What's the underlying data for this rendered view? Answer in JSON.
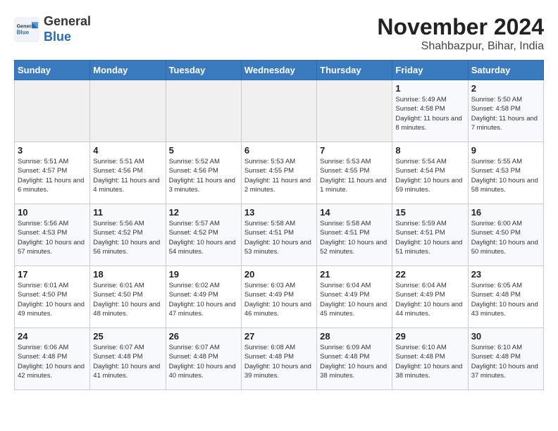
{
  "header": {
    "logo_general": "General",
    "logo_blue": "Blue",
    "month_year": "November 2024",
    "location": "Shahbazpur, Bihar, India"
  },
  "weekdays": [
    "Sunday",
    "Monday",
    "Tuesday",
    "Wednesday",
    "Thursday",
    "Friday",
    "Saturday"
  ],
  "weeks": [
    [
      {
        "day": "",
        "info": ""
      },
      {
        "day": "",
        "info": ""
      },
      {
        "day": "",
        "info": ""
      },
      {
        "day": "",
        "info": ""
      },
      {
        "day": "",
        "info": ""
      },
      {
        "day": "1",
        "info": "Sunrise: 5:49 AM\nSunset: 4:58 PM\nDaylight: 11 hours and 8 minutes."
      },
      {
        "day": "2",
        "info": "Sunrise: 5:50 AM\nSunset: 4:58 PM\nDaylight: 11 hours and 7 minutes."
      }
    ],
    [
      {
        "day": "3",
        "info": "Sunrise: 5:51 AM\nSunset: 4:57 PM\nDaylight: 11 hours and 6 minutes."
      },
      {
        "day": "4",
        "info": "Sunrise: 5:51 AM\nSunset: 4:56 PM\nDaylight: 11 hours and 4 minutes."
      },
      {
        "day": "5",
        "info": "Sunrise: 5:52 AM\nSunset: 4:56 PM\nDaylight: 11 hours and 3 minutes."
      },
      {
        "day": "6",
        "info": "Sunrise: 5:53 AM\nSunset: 4:55 PM\nDaylight: 11 hours and 2 minutes."
      },
      {
        "day": "7",
        "info": "Sunrise: 5:53 AM\nSunset: 4:55 PM\nDaylight: 11 hours and 1 minute."
      },
      {
        "day": "8",
        "info": "Sunrise: 5:54 AM\nSunset: 4:54 PM\nDaylight: 10 hours and 59 minutes."
      },
      {
        "day": "9",
        "info": "Sunrise: 5:55 AM\nSunset: 4:53 PM\nDaylight: 10 hours and 58 minutes."
      }
    ],
    [
      {
        "day": "10",
        "info": "Sunrise: 5:56 AM\nSunset: 4:53 PM\nDaylight: 10 hours and 57 minutes."
      },
      {
        "day": "11",
        "info": "Sunrise: 5:56 AM\nSunset: 4:52 PM\nDaylight: 10 hours and 56 minutes."
      },
      {
        "day": "12",
        "info": "Sunrise: 5:57 AM\nSunset: 4:52 PM\nDaylight: 10 hours and 54 minutes."
      },
      {
        "day": "13",
        "info": "Sunrise: 5:58 AM\nSunset: 4:51 PM\nDaylight: 10 hours and 53 minutes."
      },
      {
        "day": "14",
        "info": "Sunrise: 5:58 AM\nSunset: 4:51 PM\nDaylight: 10 hours and 52 minutes."
      },
      {
        "day": "15",
        "info": "Sunrise: 5:59 AM\nSunset: 4:51 PM\nDaylight: 10 hours and 51 minutes."
      },
      {
        "day": "16",
        "info": "Sunrise: 6:00 AM\nSunset: 4:50 PM\nDaylight: 10 hours and 50 minutes."
      }
    ],
    [
      {
        "day": "17",
        "info": "Sunrise: 6:01 AM\nSunset: 4:50 PM\nDaylight: 10 hours and 49 minutes."
      },
      {
        "day": "18",
        "info": "Sunrise: 6:01 AM\nSunset: 4:50 PM\nDaylight: 10 hours and 48 minutes."
      },
      {
        "day": "19",
        "info": "Sunrise: 6:02 AM\nSunset: 4:49 PM\nDaylight: 10 hours and 47 minutes."
      },
      {
        "day": "20",
        "info": "Sunrise: 6:03 AM\nSunset: 4:49 PM\nDaylight: 10 hours and 46 minutes."
      },
      {
        "day": "21",
        "info": "Sunrise: 6:04 AM\nSunset: 4:49 PM\nDaylight: 10 hours and 45 minutes."
      },
      {
        "day": "22",
        "info": "Sunrise: 6:04 AM\nSunset: 4:49 PM\nDaylight: 10 hours and 44 minutes."
      },
      {
        "day": "23",
        "info": "Sunrise: 6:05 AM\nSunset: 4:48 PM\nDaylight: 10 hours and 43 minutes."
      }
    ],
    [
      {
        "day": "24",
        "info": "Sunrise: 6:06 AM\nSunset: 4:48 PM\nDaylight: 10 hours and 42 minutes."
      },
      {
        "day": "25",
        "info": "Sunrise: 6:07 AM\nSunset: 4:48 PM\nDaylight: 10 hours and 41 minutes."
      },
      {
        "day": "26",
        "info": "Sunrise: 6:07 AM\nSunset: 4:48 PM\nDaylight: 10 hours and 40 minutes."
      },
      {
        "day": "27",
        "info": "Sunrise: 6:08 AM\nSunset: 4:48 PM\nDaylight: 10 hours and 39 minutes."
      },
      {
        "day": "28",
        "info": "Sunrise: 6:09 AM\nSunset: 4:48 PM\nDaylight: 10 hours and 38 minutes."
      },
      {
        "day": "29",
        "info": "Sunrise: 6:10 AM\nSunset: 4:48 PM\nDaylight: 10 hours and 38 minutes."
      },
      {
        "day": "30",
        "info": "Sunrise: 6:10 AM\nSunset: 4:48 PM\nDaylight: 10 hours and 37 minutes."
      }
    ]
  ]
}
